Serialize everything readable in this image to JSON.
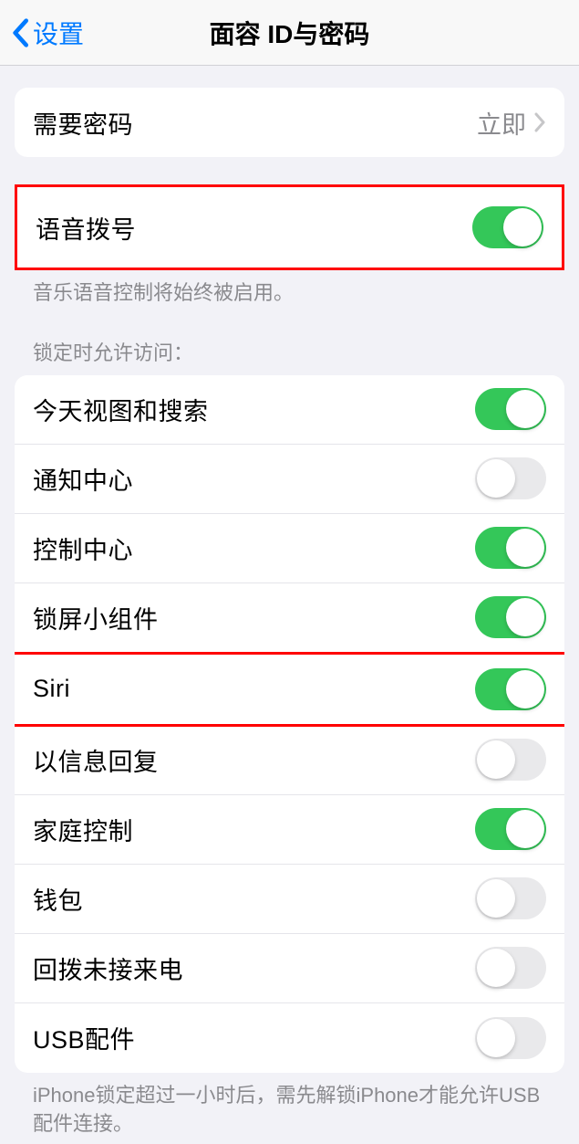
{
  "nav": {
    "back_label": "设置",
    "title": "面容 ID与密码"
  },
  "passcode_row": {
    "label": "需要密码",
    "value": "立即"
  },
  "voice_dial": {
    "label": "语音拨号",
    "on": true,
    "footer": "音乐语音控制将始终被启用。"
  },
  "lock_access": {
    "header": "锁定时允许访问：",
    "items": [
      {
        "label": "今天视图和搜索",
        "on": true,
        "highlighted": false
      },
      {
        "label": "通知中心",
        "on": false,
        "highlighted": false
      },
      {
        "label": "控制中心",
        "on": true,
        "highlighted": false
      },
      {
        "label": "锁屏小组件",
        "on": true,
        "highlighted": false
      },
      {
        "label": "Siri",
        "on": true,
        "highlighted": true
      },
      {
        "label": "以信息回复",
        "on": false,
        "highlighted": false
      },
      {
        "label": "家庭控制",
        "on": true,
        "highlighted": false
      },
      {
        "label": "钱包",
        "on": false,
        "highlighted": false
      },
      {
        "label": "回拨未接来电",
        "on": false,
        "highlighted": false
      },
      {
        "label": "USB配件",
        "on": false,
        "highlighted": false
      }
    ],
    "footer": "iPhone锁定超过一小时后，需先解锁iPhone才能允许USB配件连接。"
  }
}
